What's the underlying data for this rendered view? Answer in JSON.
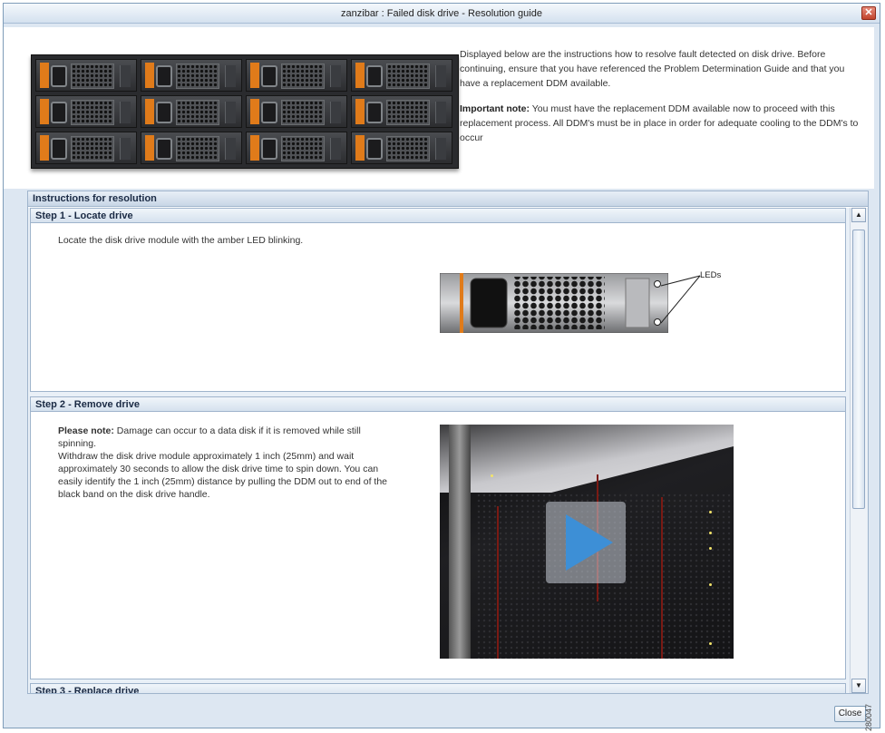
{
  "window": {
    "title": "zanzibar : Failed disk drive - Resolution guide",
    "close_glyph": "✕"
  },
  "intro": {
    "line1": "Displayed below are the instructions how to resolve fault detected on disk drive. Before continuing, ensure that you have referenced the Problem Determination Guide and that you have a replacement DDM available.",
    "important_label": "Important note:",
    "important_text": " You must have the replacement DDM available now to proceed with this replacement process.  All DDM's must be in place in order for adequate cooling to the DDM's to occur"
  },
  "instructions": {
    "header": "Instructions for resolution",
    "steps": [
      {
        "title": "Step 1 - Locate drive",
        "text": "Locate the disk drive module with the amber LED blinking.",
        "leds_label": "LEDs"
      },
      {
        "title": "Step 2 - Remove drive",
        "note_label": "Please note:",
        "note_text": " Damage can occur to a data disk if it is removed while still spinning.",
        "text": "Withdraw the disk drive module approximately 1 inch (25mm) and wait approximately 30 seconds to allow the disk drive time to spin down. You can easily identify the 1 inch (25mm) distance by pulling the DDM out to end of the black band on the disk drive handle."
      },
      {
        "title": "Step 3 - Replace drive"
      }
    ]
  },
  "scrollbar": {
    "up_glyph": "▲",
    "down_glyph": "▼"
  },
  "footer": {
    "close_label": "Close",
    "figure_id": "280047"
  },
  "icons": {
    "window_close": "close-icon",
    "play": "play-icon",
    "scroll_up": "arrow-up-icon",
    "scroll_down": "arrow-down-icon"
  },
  "colors": {
    "drive_handle": "#e07b1a",
    "play": "#3d8fd6",
    "window_bg": "#dde7f2"
  }
}
